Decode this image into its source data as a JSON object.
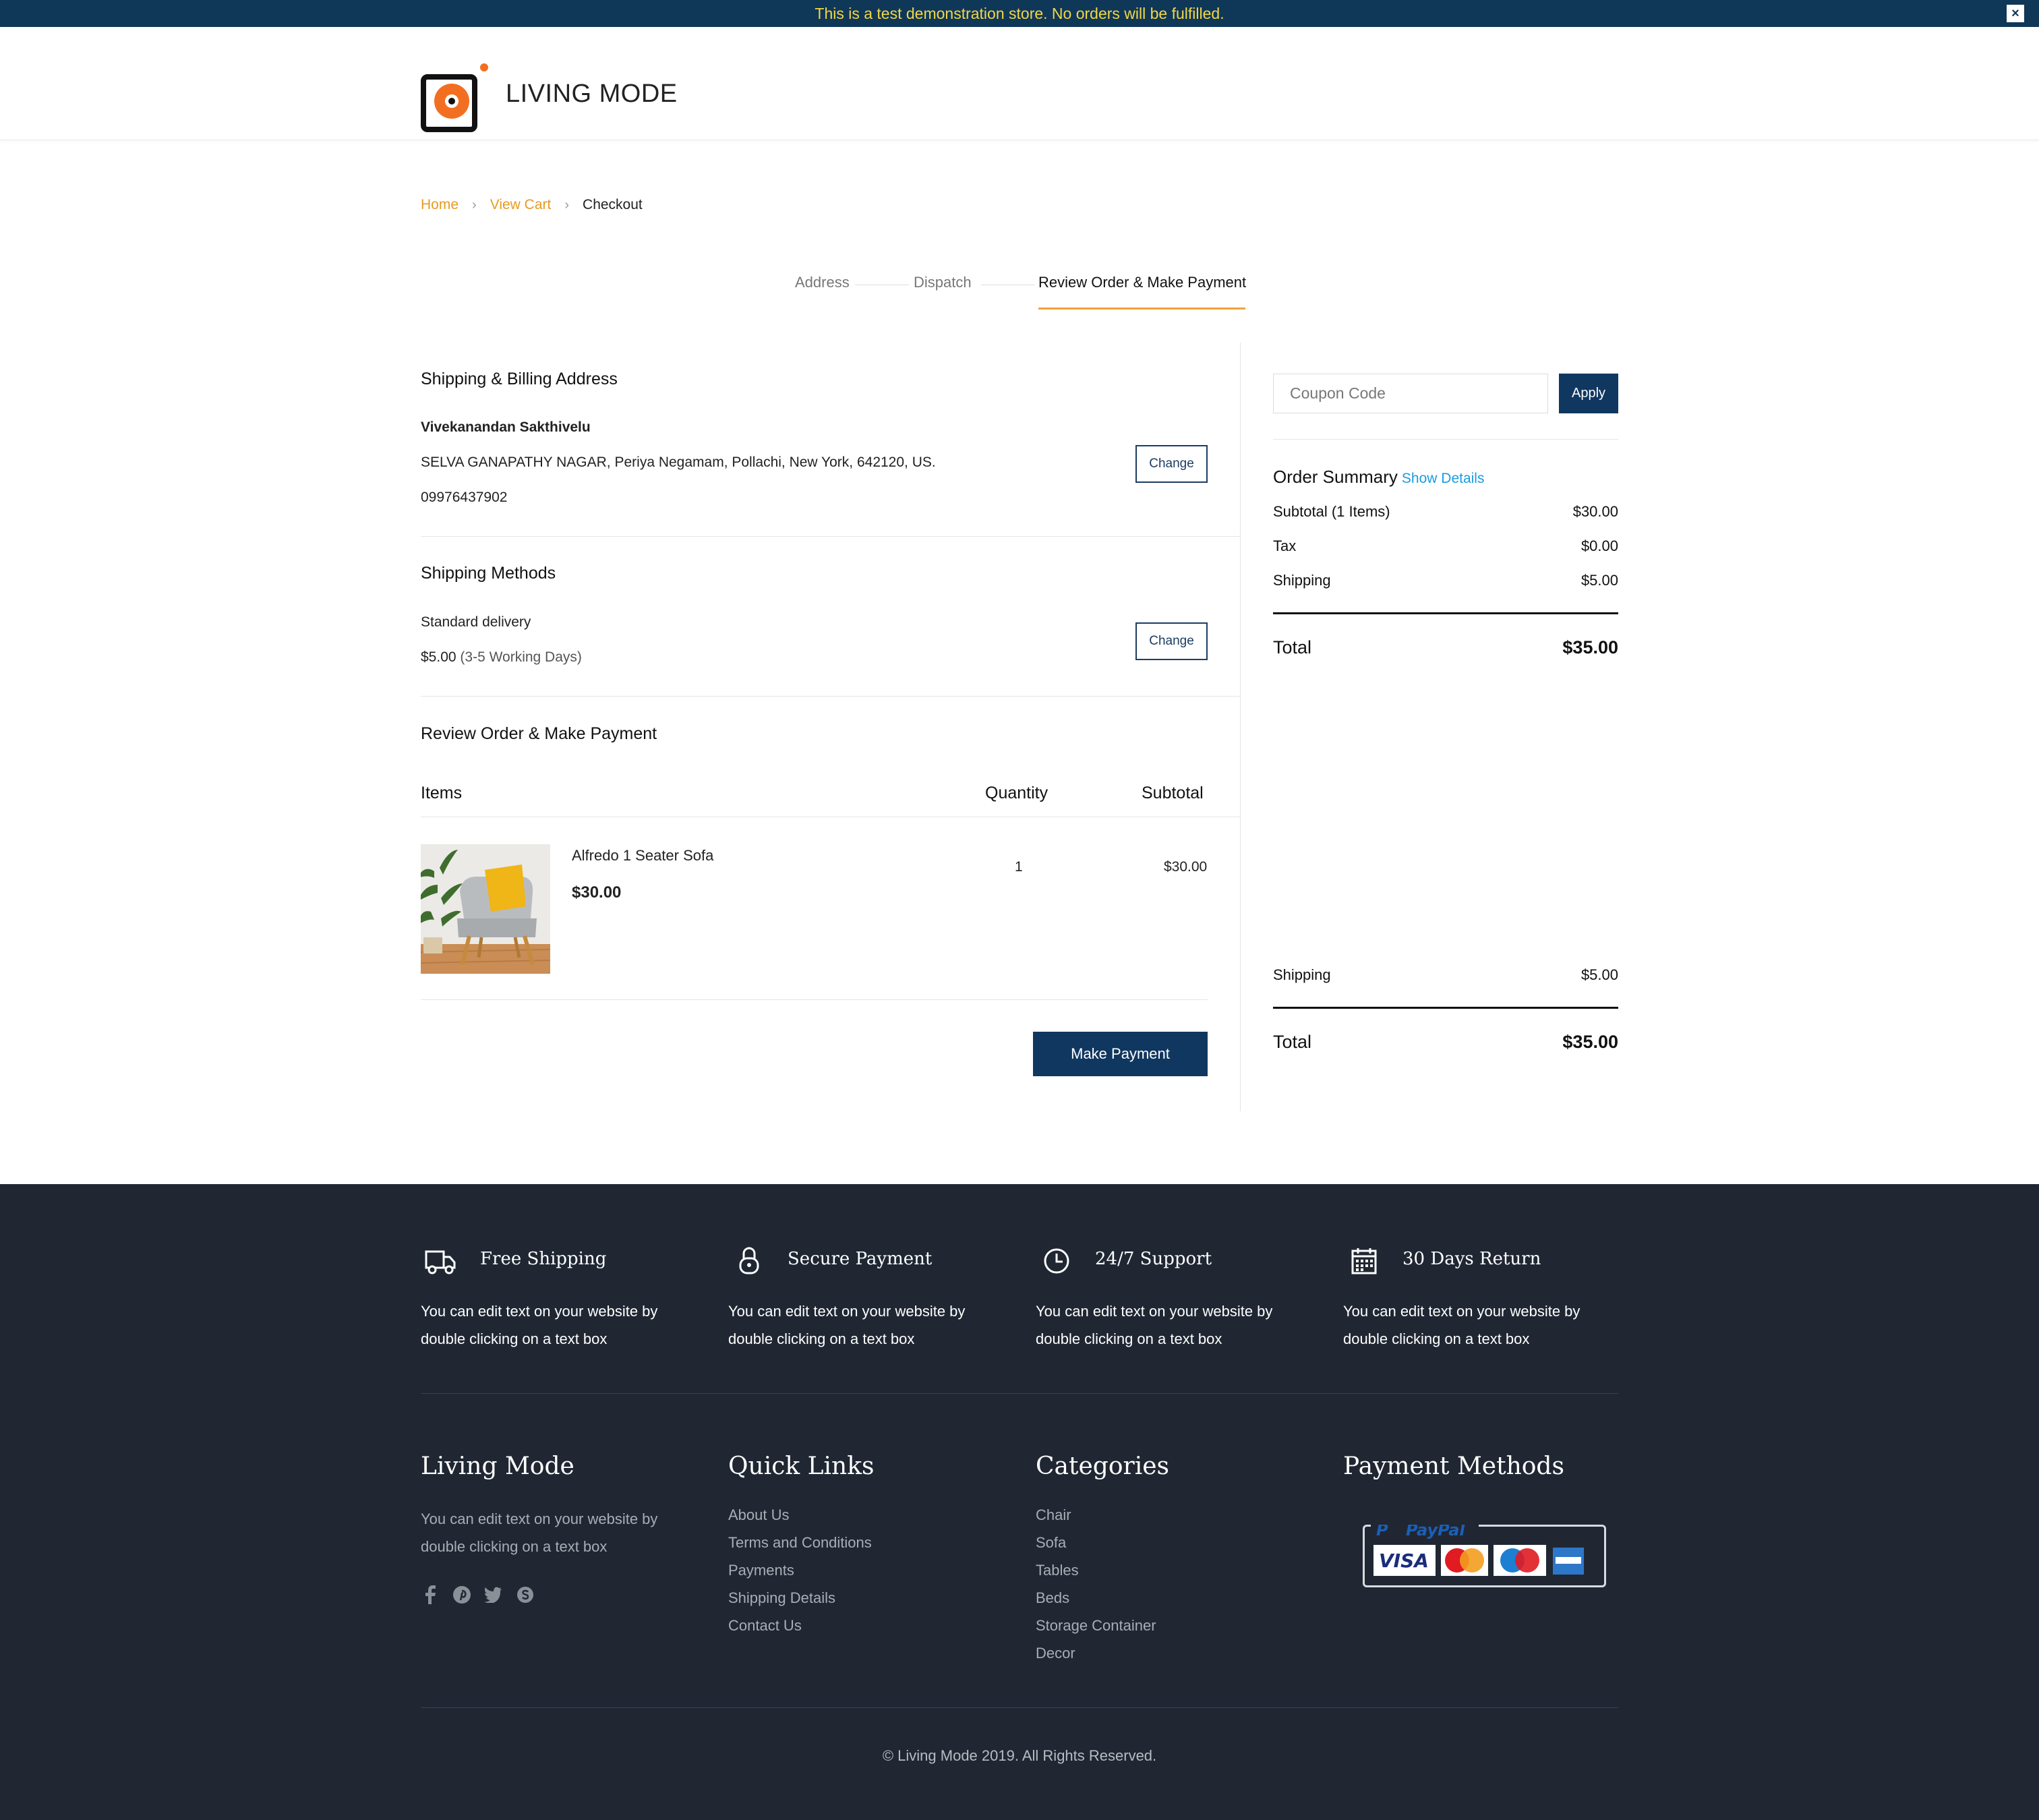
{
  "banner": {
    "text": "This is a test demonstration store. No orders will be fulfilled.",
    "close": "×"
  },
  "header": {
    "logo_text": "LIVING MODE"
  },
  "breadcrumb": {
    "home": "Home",
    "view_cart": "View Cart",
    "current": "Checkout",
    "separator": "›"
  },
  "steps": {
    "address": "Address",
    "dispatch": "Dispatch",
    "review": "Review Order & Make Payment",
    "active": "review"
  },
  "shipping_address": {
    "title": "Shipping & Billing Address",
    "name": "Vivekanandan Sakthivelu",
    "address": "SELVA GANAPATHY NAGAR, Periya Negamam,  Pollachi,  New York, 642120, US.",
    "phone": "09976437902",
    "change_label": "Change"
  },
  "shipping_methods": {
    "title": "Shipping Methods",
    "method": "Standard delivery",
    "price": "$5.00",
    "duration": "(3-5 Working Days)",
    "change_label": "Change"
  },
  "review": {
    "title": "Review Order & Make Payment",
    "headers": {
      "items": "Items",
      "quantity": "Quantity",
      "subtotal": "Subtotal"
    },
    "items": [
      {
        "name": "Alfredo 1 Seater Sofa",
        "price": "$30.00",
        "quantity": "1",
        "subtotal": "$30.00",
        "image": "armchair-with-yellow-cushion-photo"
      }
    ],
    "make_payment_label": "Make Payment"
  },
  "coupon": {
    "placeholder": "Coupon Code",
    "apply_label": "Apply"
  },
  "summary": {
    "title": "Order Summary",
    "show_details": "Show Details",
    "subtotal_label": "Subtotal (1 Items)",
    "subtotal": "$30.00",
    "tax_label": "Tax",
    "tax": "$0.00",
    "shipping_label": "Shipping",
    "shipping": "$5.00",
    "total_label": "Total",
    "total": "$35.00"
  },
  "summary_bottom": {
    "shipping_label": "Shipping",
    "shipping": "$5.00",
    "total_label": "Total",
    "total": "$35.00"
  },
  "features": [
    {
      "title": "Free Shipping",
      "text": "You can edit text on your website by double clicking on a text box",
      "icon": "truck-icon"
    },
    {
      "title": "Secure Payment",
      "text": "You can edit text on your website by double clicking on a text box",
      "icon": "lock-icon"
    },
    {
      "title": "24/7 Support",
      "text": "You can edit text on your website by double clicking on a text box",
      "icon": "clock-icon"
    },
    {
      "title": "30 Days Return",
      "text": "You can edit text on your website by double clicking on a text box",
      "icon": "calendar-icon"
    }
  ],
  "footer": {
    "about": {
      "title": "Living Mode",
      "text": "You can edit text on your website by double clicking on a text box"
    },
    "quick_links": {
      "title": "Quick Links",
      "links": [
        "About Us",
        "Terms and Conditions",
        "Payments",
        "Shipping Details",
        "Contact Us"
      ]
    },
    "categories": {
      "title": "Categories",
      "links": [
        "Chair",
        "Sofa",
        "Tables",
        "Beds",
        "Storage Container",
        "Decor"
      ]
    },
    "payment": {
      "title": "Payment Methods",
      "brands": [
        "PayPal",
        "VISA",
        "MasterCard",
        "Maestro",
        "American Express"
      ]
    },
    "social": [
      "facebook-icon",
      "pinterest-icon",
      "twitter-icon",
      "skype-icon"
    ],
    "copyright": "© Living Mode 2019. All Rights Reserved."
  },
  "colors": {
    "accent": "#f0a23a",
    "brand_navy": "#103760",
    "footer_bg": "#202733",
    "link_orange": "#e79a21",
    "link_blue": "#1a9be0",
    "banner_text": "#f2d646"
  }
}
